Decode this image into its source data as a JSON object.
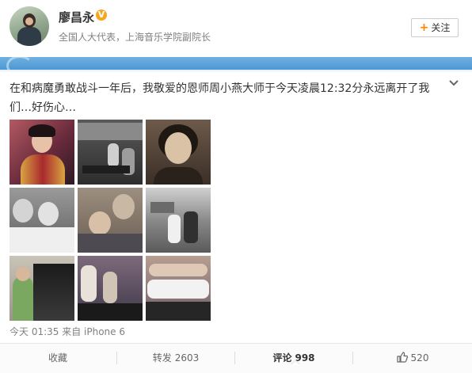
{
  "header": {
    "username": "廖昌永",
    "verified_badge": "V",
    "description": "全国人大代表，上海音乐学院副院长",
    "follow_label": "关注",
    "follow_icon": "plus-icon"
  },
  "post": {
    "text": "在和病魔勇敢战斗一年后，我敬爱的恩师周小燕大师于今天凌晨12:32分永远离开了我们…好伤心…",
    "expand_icon": "chevron-down-icon",
    "photos": [
      {
        "name": "photo-1",
        "desc_icon": "portrait-color"
      },
      {
        "name": "photo-2",
        "desc_icon": "group-bw"
      },
      {
        "name": "photo-3",
        "desc_icon": "portrait-sepia"
      },
      {
        "name": "photo-4",
        "desc_icon": "pair-bw"
      },
      {
        "name": "photo-5",
        "desc_icon": "elder-pair-color"
      },
      {
        "name": "photo-6",
        "desc_icon": "outdoor-bw"
      },
      {
        "name": "photo-7",
        "desc_icon": "piano-color"
      },
      {
        "name": "photo-8",
        "desc_icon": "piano-lesson-color"
      },
      {
        "name": "photo-9",
        "desc_icon": "class-group-color"
      }
    ],
    "source": "今天 01:35 来自 iPhone 6"
  },
  "actions": {
    "favorite_label": "收藏",
    "repost_label": "转发",
    "repost_count": "2603",
    "comment_label": "评论",
    "comment_count": "998",
    "like_count": "520",
    "like_icon": "thumbs-up-icon"
  },
  "colors": {
    "accent_orange": "#ff8200",
    "banner_blue": "#4d98d3",
    "badge_gold": "#f5a623"
  }
}
